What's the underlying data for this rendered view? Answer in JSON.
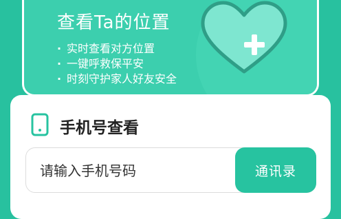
{
  "banner": {
    "title": "查看Ta的位置",
    "features": [
      "实时查看对方位置",
      "一键呼救保平安",
      "时刻守护家人好友安全"
    ]
  },
  "panel": {
    "title": "手机号查看",
    "phone_input": {
      "placeholder": "请输入手机号码",
      "value": ""
    },
    "contacts_button_label": "通讯录"
  },
  "icons": {
    "banner_icon": "heart-plus-icon",
    "panel_icon": "phone-icon"
  },
  "colors": {
    "brand": "#28c19f",
    "button": "#27c3a0",
    "heart_stroke": "#2f9e87",
    "heart_fill": "#7ee6d0"
  }
}
